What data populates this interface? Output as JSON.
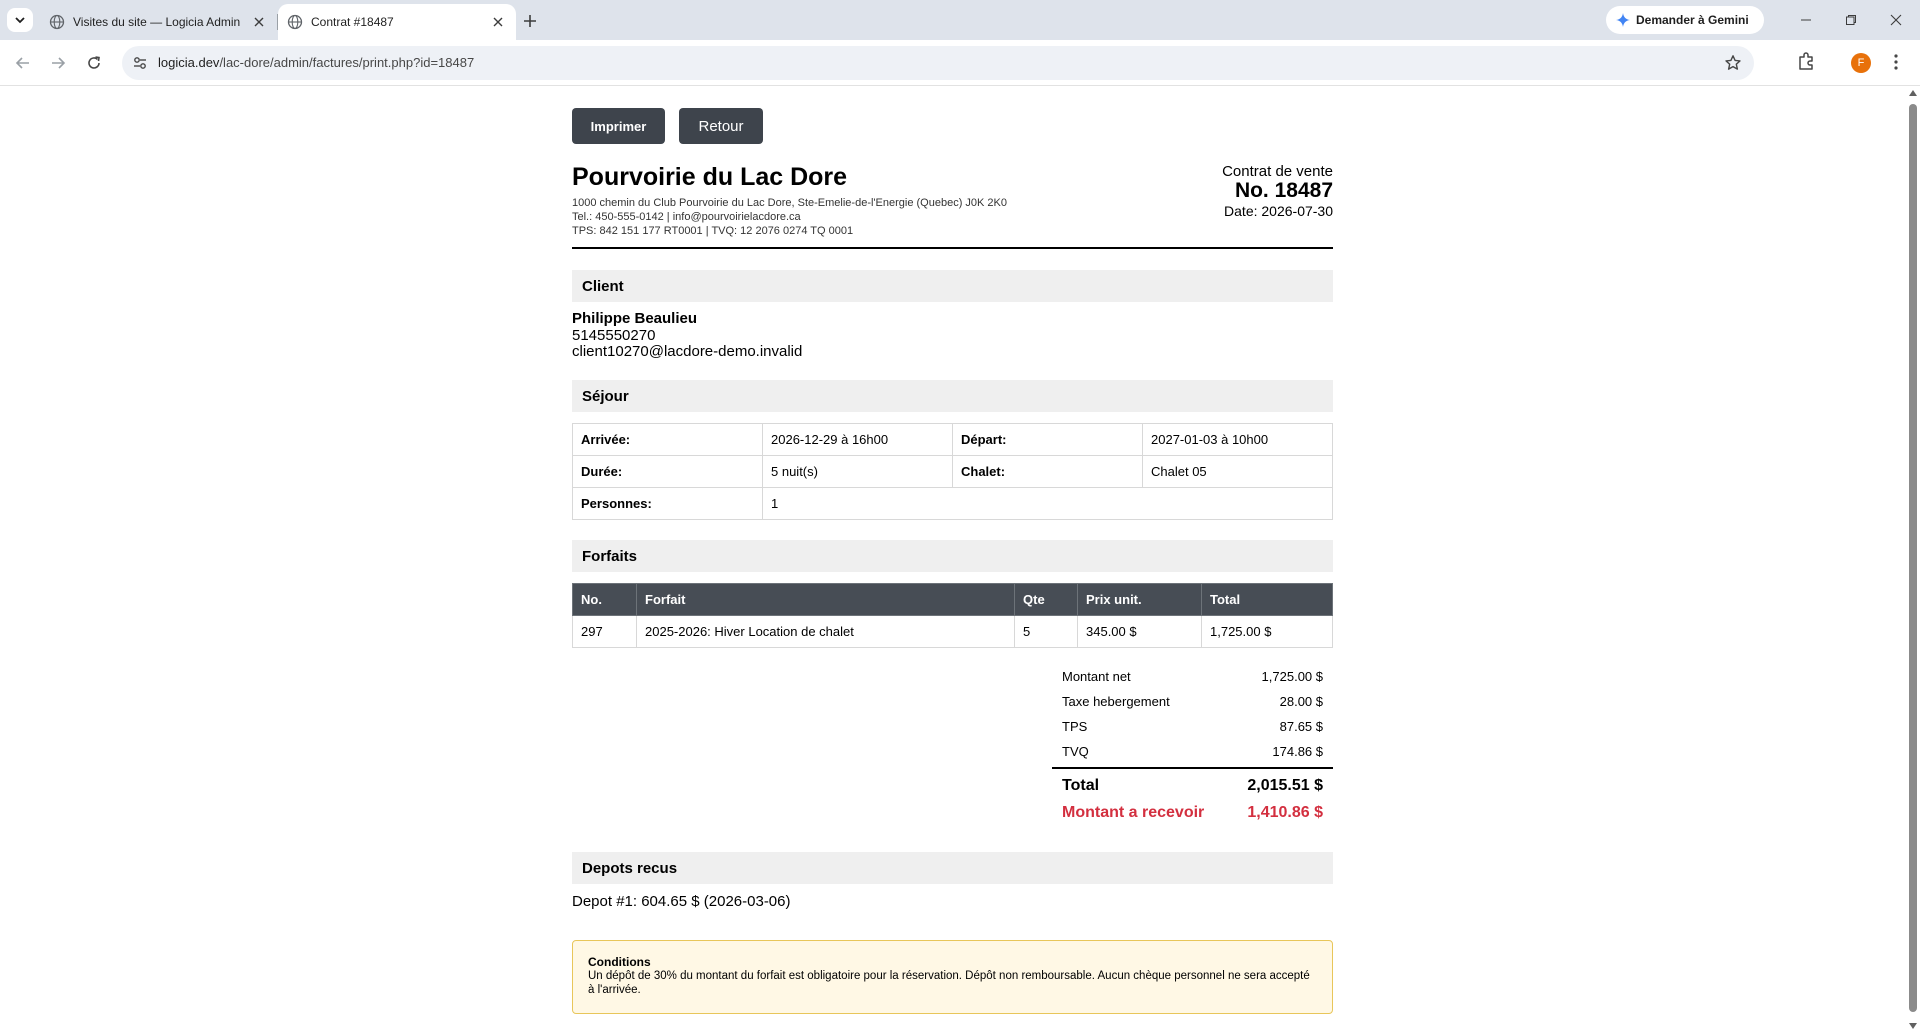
{
  "browser": {
    "tabs": [
      {
        "title": "Visites du site — Logicia Admin",
        "active": false
      },
      {
        "title": "Contrat #18487",
        "active": true
      }
    ],
    "url_domain": "logicia.dev",
    "url_path": "/lac-dore/admin/factures/print.php?id=18487",
    "gemini_label": "Demander à Gemini",
    "profile_initial": "F"
  },
  "actions": {
    "print_label": "Imprimer",
    "back_label": "Retour"
  },
  "company": {
    "name": "Pourvoirie du Lac Dore",
    "address": "1000 chemin du Club Pourvoirie du Lac Dore, Ste-Emelie-de-l'Energie (Quebec) J0K 2K0",
    "contact": "Tel.: 450-555-0142 | info@pourvoirielacdore.ca",
    "taxes": "TPS: 842 151 177 RT0001 | TVQ: 12 2076 0274 TQ 0001"
  },
  "contract": {
    "type": "Contrat de vente",
    "number": "No. 18487",
    "date": "Date: 2026-07-30"
  },
  "client": {
    "section_title": "Client",
    "name": "Philippe Beaulieu",
    "phone": "5145550270",
    "email": "client10270@lacdore-demo.invalid"
  },
  "stay": {
    "section_title": "Séjour",
    "arrival_label": "Arrivée:",
    "arrival_value": "2026-12-29 à 16h00",
    "departure_label": "Départ:",
    "departure_value": "2027-01-03 à 10h00",
    "duration_label": "Durée:",
    "duration_value": "5 nuit(s)",
    "chalet_label": "Chalet:",
    "chalet_value": "Chalet 05",
    "persons_label": "Personnes:",
    "persons_value": "1"
  },
  "packages": {
    "section_title": "Forfaits",
    "headers": [
      "No.",
      "Forfait",
      "Qte",
      "Prix unit.",
      "Total"
    ],
    "rows": [
      [
        "297",
        "2025-2026: Hiver Location de chalet",
        "5",
        "345.00 $",
        "1,725.00 $"
      ]
    ]
  },
  "totals": {
    "net_label": "Montant net",
    "net_value": "1,725.00 $",
    "lodging_tax_label": "Taxe hebergement",
    "lodging_tax_value": "28.00 $",
    "tps_label": "TPS",
    "tps_value": "87.65 $",
    "tvq_label": "TVQ",
    "tvq_value": "174.86 $",
    "total_label": "Total",
    "total_value": "2,015.51 $",
    "due_label": "Montant a recevoir",
    "due_value": "1,410.86 $",
    "due_color": "#d32f3f"
  },
  "deposits": {
    "section_title": "Depots recus",
    "items": [
      "Depot #1: 604.65 $ (2026-03-06)"
    ]
  },
  "conditions": {
    "title": "Conditions",
    "text": "Un dépôt de 30% du montant du forfait est obligatoire pour la réservation. Dépôt non remboursable. Aucun chèque personnel ne sera accepté à l'arrivée."
  }
}
